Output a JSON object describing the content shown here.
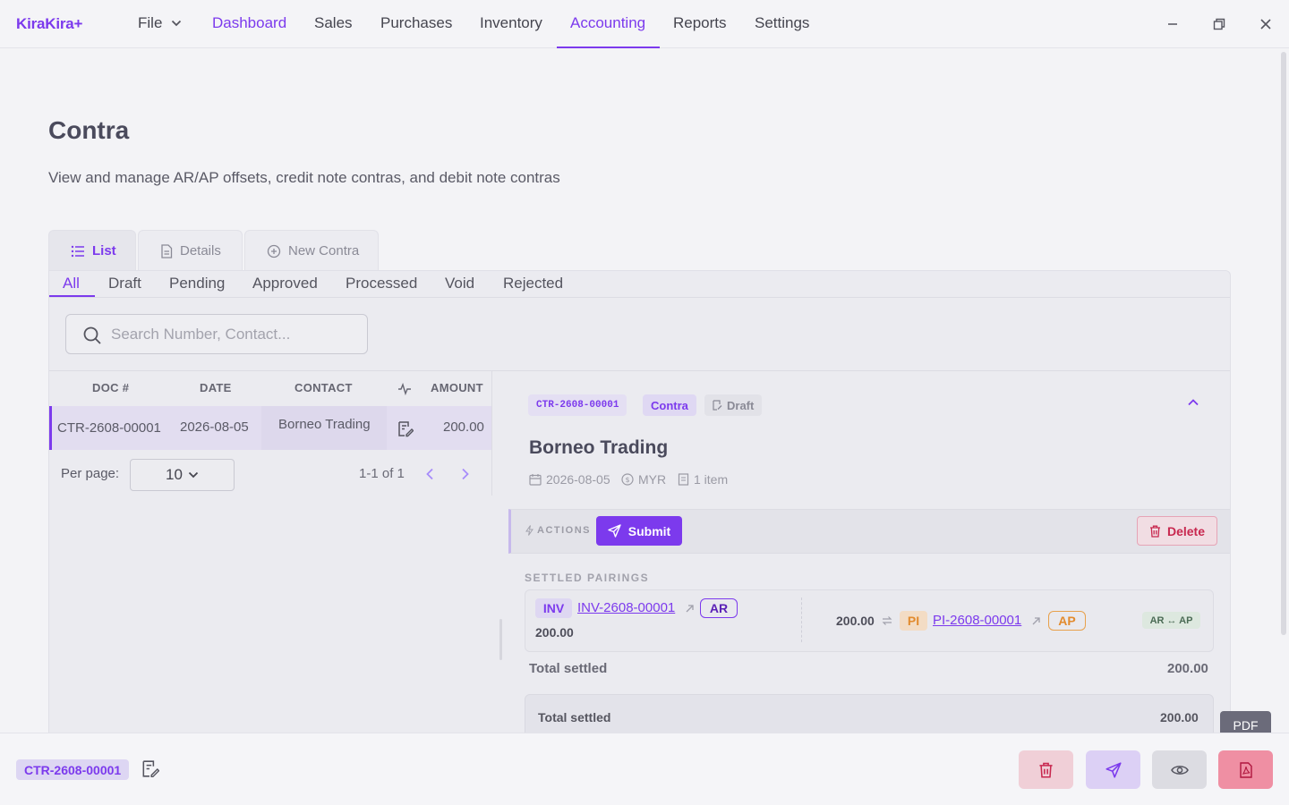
{
  "app": {
    "logo": "KiraKira+"
  },
  "nav": {
    "file": "File",
    "items": [
      "Dashboard",
      "Sales",
      "Purchases",
      "Inventory",
      "Accounting",
      "Reports",
      "Settings"
    ],
    "active": "Accounting"
  },
  "page": {
    "title": "Contra",
    "subtitle": "View and manage AR/AP offsets, credit note contras, and debit note contras"
  },
  "tabs": {
    "list": "List",
    "details": "Details",
    "new": "New Contra"
  },
  "status_tabs": [
    "All",
    "Draft",
    "Pending",
    "Approved",
    "Processed",
    "Void",
    "Rejected"
  ],
  "search": {
    "placeholder": "Search Number, Contact..."
  },
  "table": {
    "headers": {
      "doc": "DOC #",
      "date": "DATE",
      "contact": "CONTACT",
      "amount": "AMOUNT"
    },
    "rows": [
      {
        "doc": "CTR-2608-00001",
        "date": "2026-08-05",
        "contact": "Borneo Trading",
        "amount": "200.00"
      }
    ]
  },
  "pagination": {
    "per_page_label": "Per page:",
    "per_page": "10",
    "range": "1-1 of 1"
  },
  "detail": {
    "code": "CTR-2608-00001",
    "type": "Contra",
    "status": "Draft",
    "name": "Borneo Trading",
    "date": "2026-08-05",
    "currency": "MYR",
    "items": "1 item",
    "actions_label": "ACTIONS",
    "submit": "Submit",
    "delete": "Delete",
    "settled_title": "SETTLED PAIRINGS",
    "pairing": {
      "left_tag": "INV",
      "left_doc": "INV-2608-00001",
      "left_kind": "AR",
      "left_amount": "200.00",
      "right_amount": "200.00",
      "right_tag": "PI",
      "right_doc": "PI-2608-00001",
      "right_kind": "AP",
      "relation": "AR ↔ AP"
    },
    "total_label": "Total settled",
    "total_value": "200.00",
    "total2_label": "Total settled",
    "total2_value": "200.00"
  },
  "tooltip": {
    "pdf": "PDF"
  },
  "bottom": {
    "code": "CTR-2608-00001"
  },
  "colors": {
    "accent": "#7c3aed",
    "danger": "#c8284f",
    "warning": "#e28b2e"
  }
}
